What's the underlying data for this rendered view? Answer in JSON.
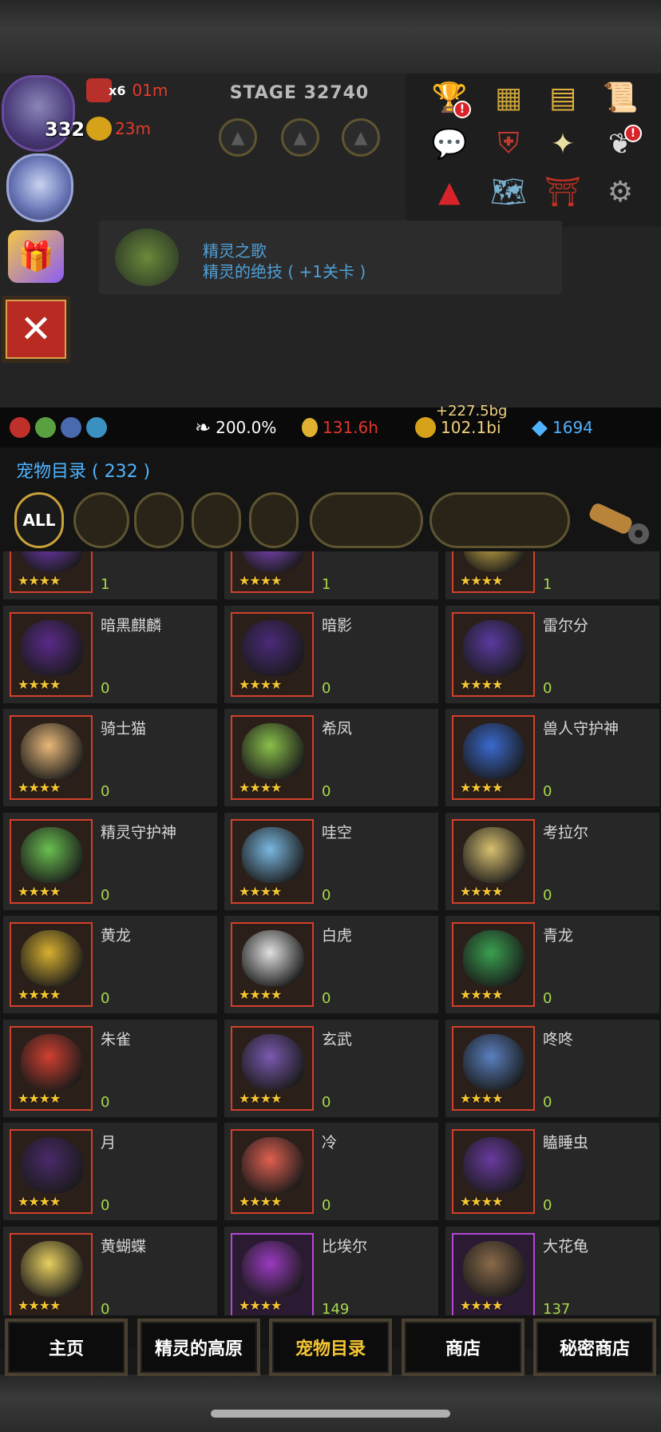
{
  "hud": {
    "player_level": "332",
    "buffs": [
      {
        "icon": "sword-icon",
        "mult": "x6",
        "time": "01m"
      },
      {
        "icon": "coin-buff-icon",
        "time": "23m"
      }
    ],
    "stage": "STAGE 32740",
    "menu_icons": [
      "trophy-icon",
      "ranking-icon",
      "book-icon",
      "scroll-icon",
      "chat-icon",
      "crossed-shield-icon",
      "angel-icon",
      "wings-icon",
      "triangle-icon",
      "map-icon",
      "shrine-icon",
      "gear-icon"
    ],
    "skill": {
      "line1": "精灵之歌",
      "line2": "精灵的绝技 ( +1关卡 )"
    },
    "close_label": "✕"
  },
  "status": {
    "speed_pct": "200.0%",
    "time_hours": "131.6h",
    "gold": "102.1bi",
    "gold_gain": "+227.5bg",
    "diamonds": "1694",
    "colors": {
      "gold": "#f0d080",
      "diamond": "#4fb3ff",
      "red": "#e0362b"
    }
  },
  "pet_panel": {
    "title": "宠物目录 ( 232 )",
    "filter_all": "ALL",
    "pets": [
      {
        "name": "",
        "count": "1",
        "frame": "red",
        "color": "#7a3cc2"
      },
      {
        "name": "",
        "count": "1",
        "frame": "red",
        "color": "#8a4ad0"
      },
      {
        "name": "",
        "count": "1",
        "frame": "red",
        "color": "#d8b84a"
      },
      {
        "name": "暗黑麒麟",
        "count": "0",
        "frame": "red",
        "color": "#5a2a8a"
      },
      {
        "name": "暗影",
        "count": "0",
        "frame": "red",
        "color": "#4a2a7a"
      },
      {
        "name": "雷尔分",
        "count": "0",
        "frame": "red",
        "color": "#5a3aa0"
      },
      {
        "name": "骑士猫",
        "count": "0",
        "frame": "red",
        "color": "#e8b87a"
      },
      {
        "name": "希凤",
        "count": "0",
        "frame": "red",
        "color": "#8ac04a"
      },
      {
        "name": "兽人守护神",
        "count": "0",
        "frame": "red",
        "color": "#3a6ad0"
      },
      {
        "name": "精灵守护神",
        "count": "0",
        "frame": "red",
        "color": "#6ac050"
      },
      {
        "name": "哇空",
        "count": "0",
        "frame": "red",
        "color": "#7ab8e0"
      },
      {
        "name": "考拉尔",
        "count": "0",
        "frame": "red",
        "color": "#d8c070"
      },
      {
        "name": "黄龙",
        "count": "0",
        "frame": "red",
        "color": "#d8b030"
      },
      {
        "name": "白虎",
        "count": "0",
        "frame": "red",
        "color": "#e0e0e0"
      },
      {
        "name": "青龙",
        "count": "0",
        "frame": "red",
        "color": "#3aa050"
      },
      {
        "name": "朱雀",
        "count": "0",
        "frame": "red",
        "color": "#d04030"
      },
      {
        "name": "玄武",
        "count": "0",
        "frame": "red",
        "color": "#7a5ab0"
      },
      {
        "name": "咚咚",
        "count": "0",
        "frame": "red",
        "color": "#5a80c0"
      },
      {
        "name": "月",
        "count": "0",
        "frame": "red",
        "color": "#4a2a6a"
      },
      {
        "name": "冷",
        "count": "0",
        "frame": "red",
        "color": "#e06050"
      },
      {
        "name": "瞌睡虫",
        "count": "0",
        "frame": "red",
        "color": "#6a3aa0"
      },
      {
        "name": "黄蝴蝶",
        "count": "0",
        "frame": "red",
        "color": "#e8d060"
      },
      {
        "name": "比埃尔",
        "count": "149",
        "frame": "purple",
        "color": "#9a3ac0"
      },
      {
        "name": "大花龟",
        "count": "137",
        "frame": "purple",
        "color": "#8a6a4a"
      }
    ],
    "stars": "★★★★"
  },
  "nav": [
    {
      "label": "主页",
      "active": false
    },
    {
      "label": "精灵的高原",
      "active": false
    },
    {
      "label": "宠物目录",
      "active": true
    },
    {
      "label": "商店",
      "active": false
    },
    {
      "label": "秘密商店",
      "active": false
    }
  ]
}
